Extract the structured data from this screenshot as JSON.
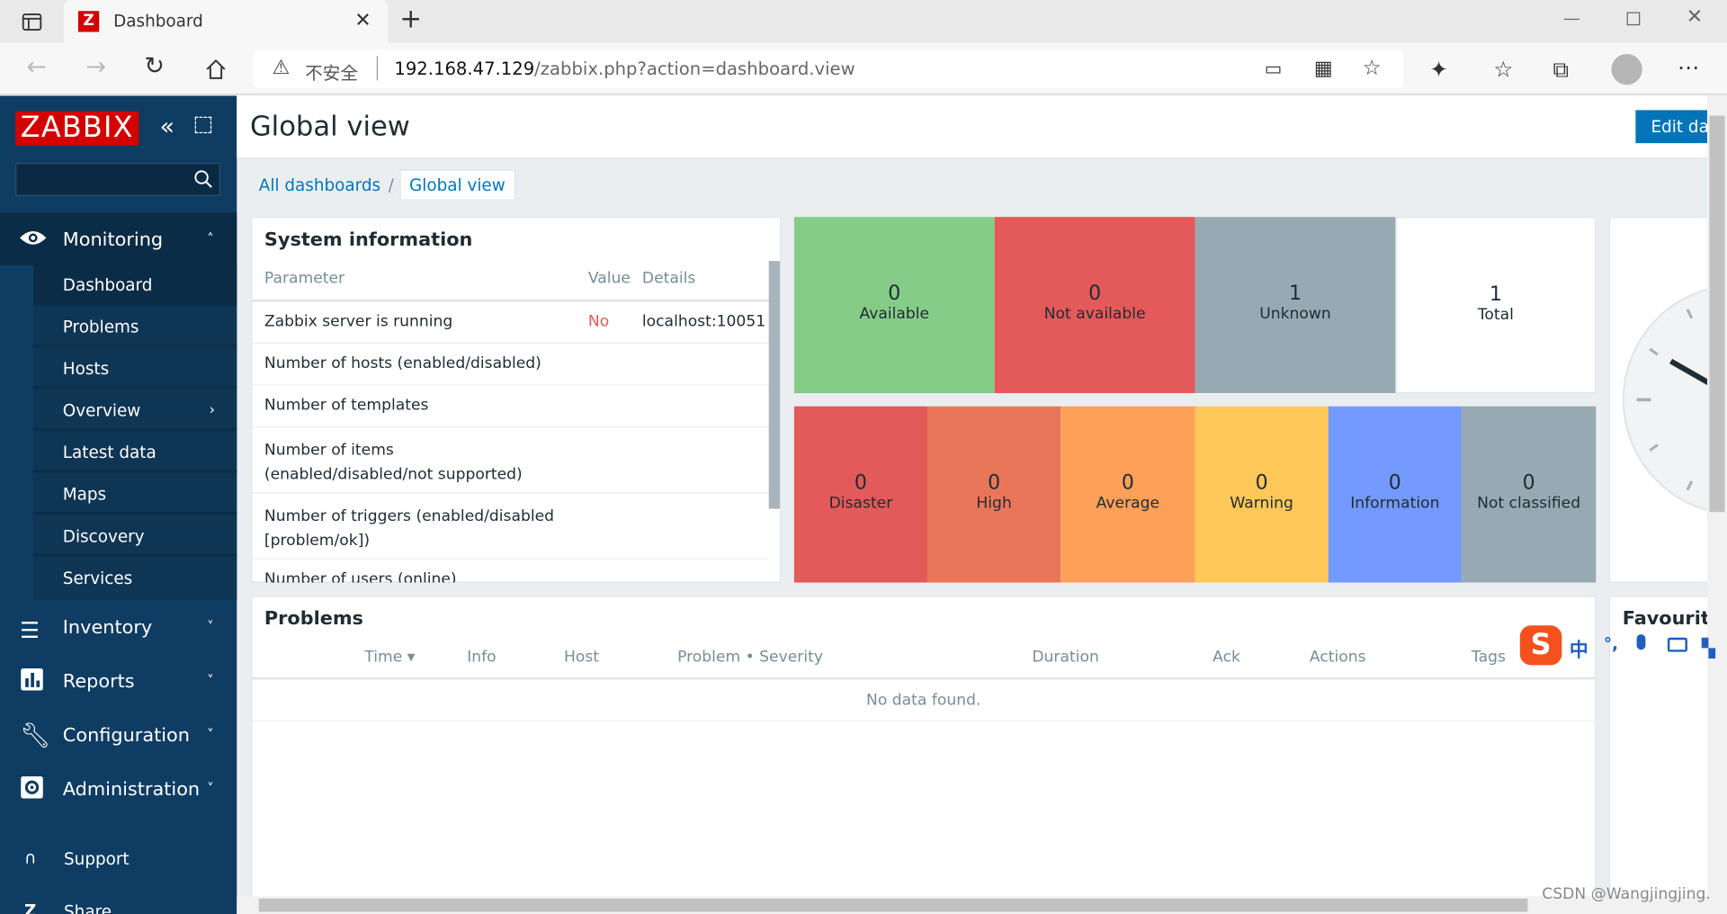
{
  "browser": {
    "tab_title": "Dashboard",
    "security_label": "不安全",
    "url_host": "192.168.47.129",
    "url_path": "/zabbix.php?action=dashboard.view"
  },
  "sidebar": {
    "logo": "ZABBIX",
    "search_placeholder": "",
    "monitoring_label": "Monitoring",
    "monitoring_items": [
      "Dashboard",
      "Problems",
      "Hosts",
      "Overview",
      "Latest data",
      "Maps",
      "Discovery",
      "Services"
    ],
    "inventory_label": "Inventory",
    "reports_label": "Reports",
    "configuration_label": "Configuration",
    "administration_label": "Administration",
    "support_label": "Support",
    "share_label": "Share"
  },
  "header": {
    "title": "Global view",
    "edit_button": "Edit das"
  },
  "breadcrumb": {
    "root": "All dashboards",
    "separator": "/",
    "current": "Global view"
  },
  "system_info": {
    "title": "System information",
    "columns": [
      "Parameter",
      "Value",
      "Details"
    ],
    "rows": [
      {
        "parameter": "Zabbix server is running",
        "value": "No",
        "details": "localhost:10051"
      },
      {
        "parameter": "Number of hosts (enabled/disabled)",
        "value": "",
        "details": ""
      },
      {
        "parameter": "Number of templates",
        "value": "",
        "details": ""
      },
      {
        "parameter": "Number of items (enabled/disabled/not supported)",
        "value": "",
        "details": ""
      },
      {
        "parameter": "Number of triggers (enabled/disabled [problem/ok])",
        "value": "",
        "details": ""
      },
      {
        "parameter": "Number of users (online)",
        "value": "",
        "details": ""
      }
    ]
  },
  "host_availability": [
    {
      "count": "0",
      "label": "Available",
      "color": "#86cc89"
    },
    {
      "count": "0",
      "label": "Not available",
      "color": "#e45959"
    },
    {
      "count": "1",
      "label": "Unknown",
      "color": "#97aab3"
    },
    {
      "count": "1",
      "label": "Total",
      "color": "#ffffff"
    }
  ],
  "severities": [
    {
      "count": "0",
      "label": "Disaster",
      "color": "#e45959"
    },
    {
      "count": "0",
      "label": "High",
      "color": "#e97659"
    },
    {
      "count": "0",
      "label": "Average",
      "color": "#ffa059"
    },
    {
      "count": "0",
      "label": "Warning",
      "color": "#ffc859"
    },
    {
      "count": "0",
      "label": "Information",
      "color": "#7499ff"
    },
    {
      "count": "0",
      "label": "Not classified",
      "color": "#97aab3"
    }
  ],
  "problems": {
    "title": "Problems",
    "columns": [
      "Time ▾",
      "Info",
      "Host",
      "Problem • Severity",
      "Duration",
      "Ack",
      "Actions",
      "Tags"
    ],
    "empty_text": "No data found."
  },
  "favourites_title": "Favourite",
  "ime_toolbar": [
    "中",
    "°,",
    "mic",
    "keyboard",
    "apps"
  ],
  "watermark": "CSDN @Wangjingjing."
}
